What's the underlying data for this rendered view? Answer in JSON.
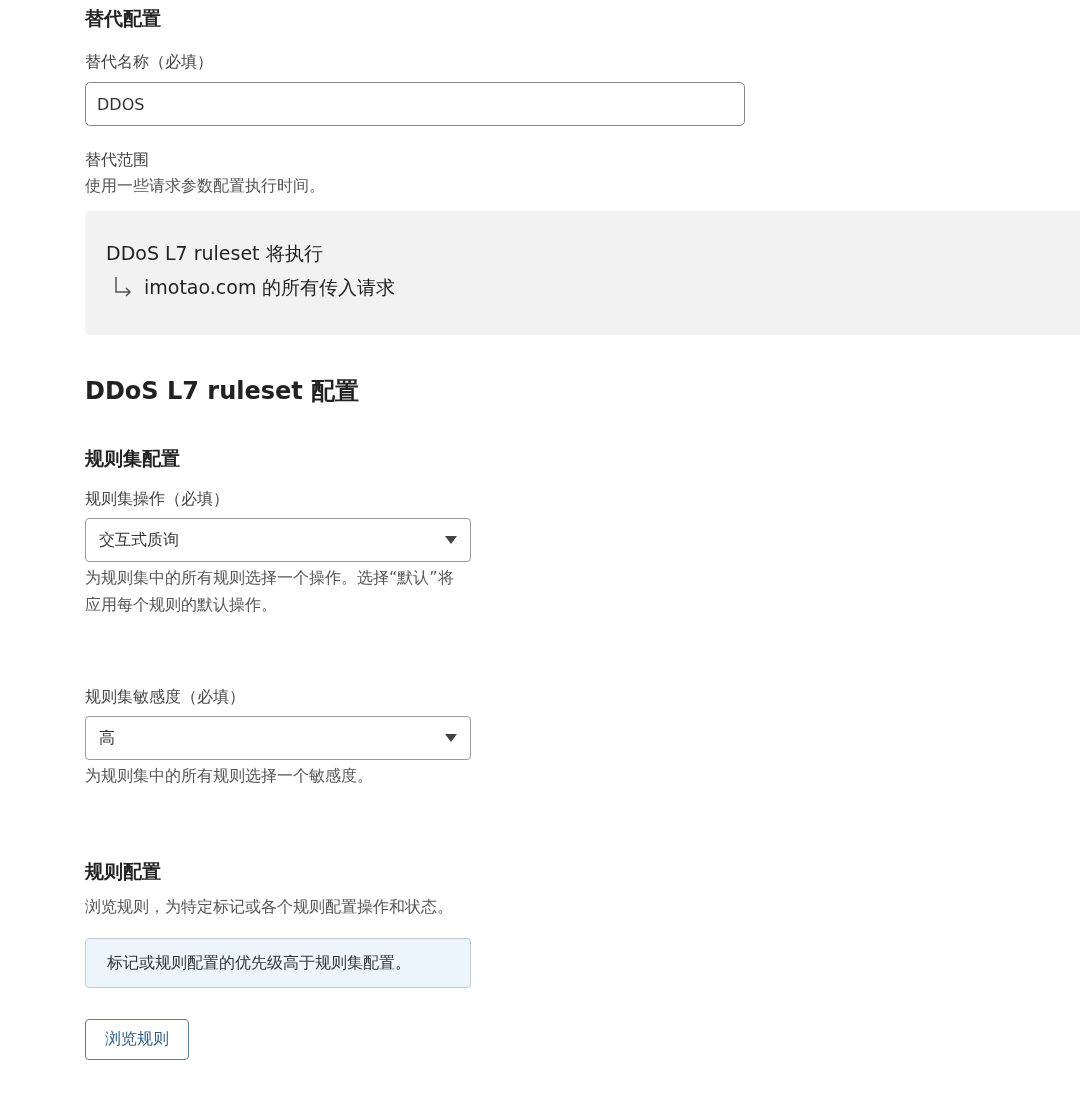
{
  "override": {
    "heading": "替代配置",
    "name_field": {
      "label": "替代名称（必填）",
      "value": "DDOS"
    },
    "scope": {
      "label": "替代范围",
      "description": "使用一些请求参数配置执行时间。",
      "ruleset_line": "DDoS L7 ruleset 将执行",
      "target_line": "imotao.com 的所有传入请求"
    }
  },
  "ruleset": {
    "heading": "DDoS L7 ruleset 配置",
    "subheading": "规则集配置",
    "selects": [
      {
        "label": "规则集操作（必填）",
        "value": "交互式质询",
        "help": "为规则集中的所有规则选择一个操作。选择“默认”将应用每个规则的默认操作。"
      },
      {
        "label": "规则集敏感度（必填）",
        "value": "高",
        "help": "为规则集中的所有规则选择一个敏感度。"
      }
    ]
  },
  "rules": {
    "heading": "规则配置",
    "description": "浏览规则，为特定标记或各个规则配置操作和状态。",
    "note": "标记或规则配置的优先级高于规则集配置。",
    "button": "浏览规则"
  }
}
